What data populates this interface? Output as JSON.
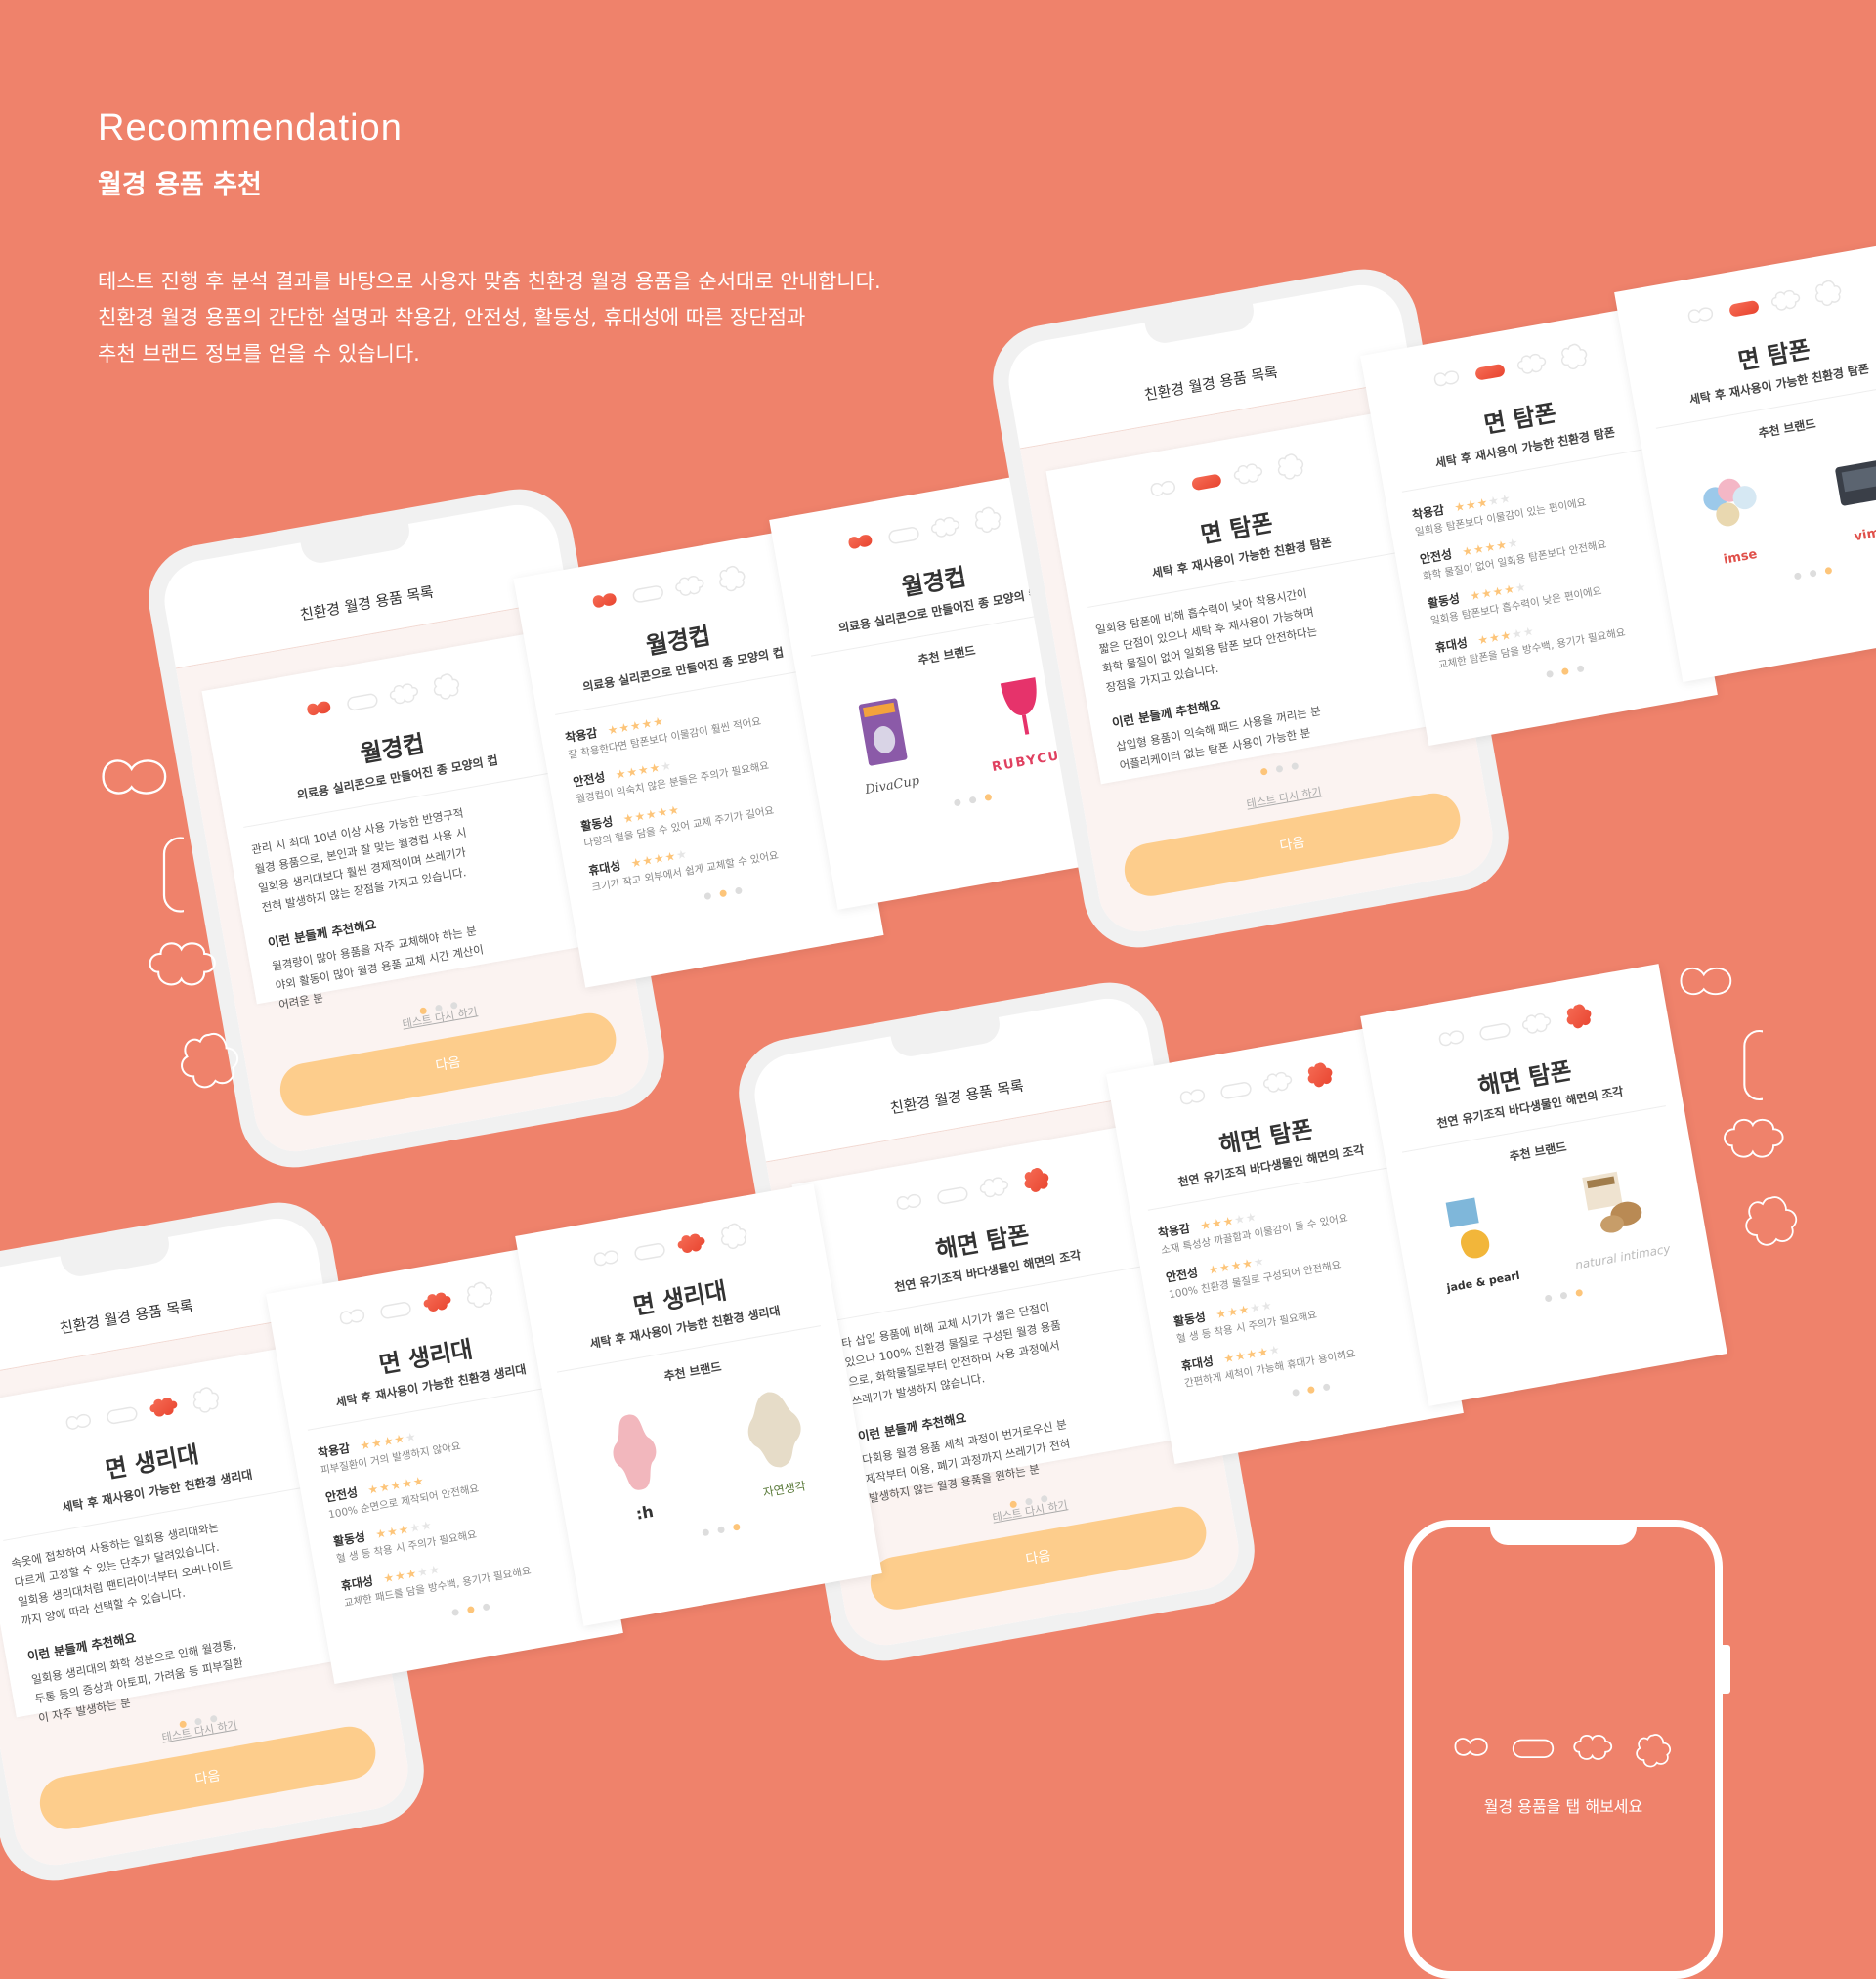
{
  "header": {
    "title": "Recommendation",
    "subtitle": "월경 용품 추천",
    "description": [
      "테스트 진행 후 분석 결과를 바탕으로 사용자 맞춤 친환경 월경 용품을 순서대로 안내합니다.",
      "친환경 월경 용품의 간단한 설명과 착용감, 안전성, 활동성, 휴대성에 따른 장단점과",
      "추천 브랜드 정보를 얻을 수 있습니다."
    ]
  },
  "common": {
    "list_title": "친환경 월경 용품 목록",
    "retest": "테스트 다시 하기",
    "next": "다음",
    "rec_heading": "이런 분들께 추천해요",
    "brand_heading": "추천 브랜드",
    "label_comfort": "착용감",
    "label_safety": "안전성",
    "label_activity": "활동성",
    "label_portable": "휴대성"
  },
  "cup": {
    "name": "월경컵",
    "desc": "의료용 실리콘으로 만들어진 종 모양의 컵",
    "body": [
      "관리 시 최대 10년 이상 사용 가능한 반영구적",
      "월경 용품으로, 본인과 잘 맞는 월경컵 사용 시",
      "일회용 생리대보다 훨씬 경제적이며 쓰레기가",
      "전혀 발생하지 않는 장점을 가지고 있습니다."
    ],
    "rec": [
      "월경량이 많아 용품을 자주 교체해야 하는 분",
      "야외 활동이 많아 월경 용품 교체 시간 계산이",
      "어려운 분"
    ],
    "ratings": [
      {
        "stars": 5,
        "desc": "잘 착용한다면 탐폰보다 이물감이 훨씬 적어요"
      },
      {
        "stars": 4,
        "desc": "월경컵이 익숙치 않은 분들은 주의가 필요해요"
      },
      {
        "stars": 5,
        "desc": "다량의 혈을 담을 수 있어 교체 주기가 길어요"
      },
      {
        "stars": 4,
        "desc": "크기가 작고 외부에서 쉽게 교체할 수 있어요"
      }
    ],
    "brands": [
      "DivaCup",
      "RUBYCUP"
    ]
  },
  "tampon": {
    "name": "면 탐폰",
    "desc": "세탁 후 재사용이 가능한 친환경 탐폰",
    "body": [
      "일회용 탐폰에 비해 흡수력이 낮아 착용시간이",
      "짧은 단점이 있으나 세탁 후 재사용이 가능하며",
      "화학 물질이 없어 일회용 탐폰 보다 안전하다는",
      "장점을 가지고 있습니다."
    ],
    "rec": [
      "삽입형 용품이 익숙해 패드 사용을 꺼리는 분",
      "어플리케이터 없는 탐폰 사용이 가능한 분"
    ],
    "ratings": [
      {
        "stars": 3,
        "desc": "일회용 탐폰보다 이물감이 있는 편이에요"
      },
      {
        "stars": 4,
        "desc": "화학 물질이 없어 일회용 탐폰보다 안전해요"
      },
      {
        "stars": 4,
        "desc": "일회용 탐폰보다 흡수력이 낮은 편이에요"
      },
      {
        "stars": 3,
        "desc": "교체한 탐폰을 담을 방수백, 용기가 필요해요"
      }
    ],
    "brands": [
      "imse",
      "vimse"
    ]
  },
  "sponge": {
    "name": "해면 탐폰",
    "desc": "천연 유기조직 바다생물인 해면의 조각",
    "body": [
      "타 삽입 용품에 비해 교체 시기가 짧은 단점이",
      "있으나 100% 친환경 물질로 구성된 월경 용품",
      "으로, 화학물질로부터 안전하며 사용 과정에서",
      "쓰레기가 발생하지 않습니다."
    ],
    "rec": [
      "다회용 월경 용품 세척 과정이 번거로우신 분",
      "제작부터 이용, 폐기 과정까지 쓰레기가 전혀",
      "발생하지 않는 월경 용품을 원하는 분"
    ],
    "ratings": [
      {
        "stars": 3,
        "desc": "소재 특성상 까끌함과 이물감이 들 수 있어요"
      },
      {
        "stars": 4,
        "desc": "100% 친환경 물질로 구성되어 안전해요"
      },
      {
        "stars": 3,
        "desc": "혈 생 등 착용 시 주의가 필요해요"
      },
      {
        "stars": 4,
        "desc": "간편하게 세척이 가능해 휴대가 용이해요"
      }
    ],
    "brands": [
      "jade & pearl",
      "natural intimacy"
    ]
  },
  "pad": {
    "name": "면 생리대",
    "desc": "세탁 후 재사용이 가능한 친환경 생리대",
    "body": [
      "속옷에 접착하여 사용하는 일회용 생리대와는",
      "다르게 고정할 수 있는 단추가 달려있습니다.",
      "일회용 생리대처럼 팬티라이너부터 오버나이트",
      "까지 양에 따라 선택할 수 있습니다."
    ],
    "rec": [
      "일회용 생리대의 화학 성분으로 인해 월경통,",
      "두통 등의 증상과 아토피, 가려움 등 피부질환",
      "이 자주 발생하는 분"
    ],
    "ratings": [
      {
        "stars": 4,
        "desc": "피부질환이 거의 발생하지 않아요"
      },
      {
        "stars": 5,
        "desc": "100% 순면으로 제작되어 안전해요"
      },
      {
        "stars": 3,
        "desc": "혈 생 등 착용 시 주의가 필요해요"
      },
      {
        "stars": 3,
        "desc": "교체한 패드를 담을 방수백, 용기가 필요해요"
      }
    ],
    "brands": [
      ":h",
      "자연생각"
    ]
  },
  "tap_phone": {
    "hint": "월경 용품을 탭 해보세요"
  },
  "colors": {
    "background": "#ef826b",
    "accent": "#f0624a",
    "button": "#fdcd8c",
    "star": "#fdc57a"
  }
}
